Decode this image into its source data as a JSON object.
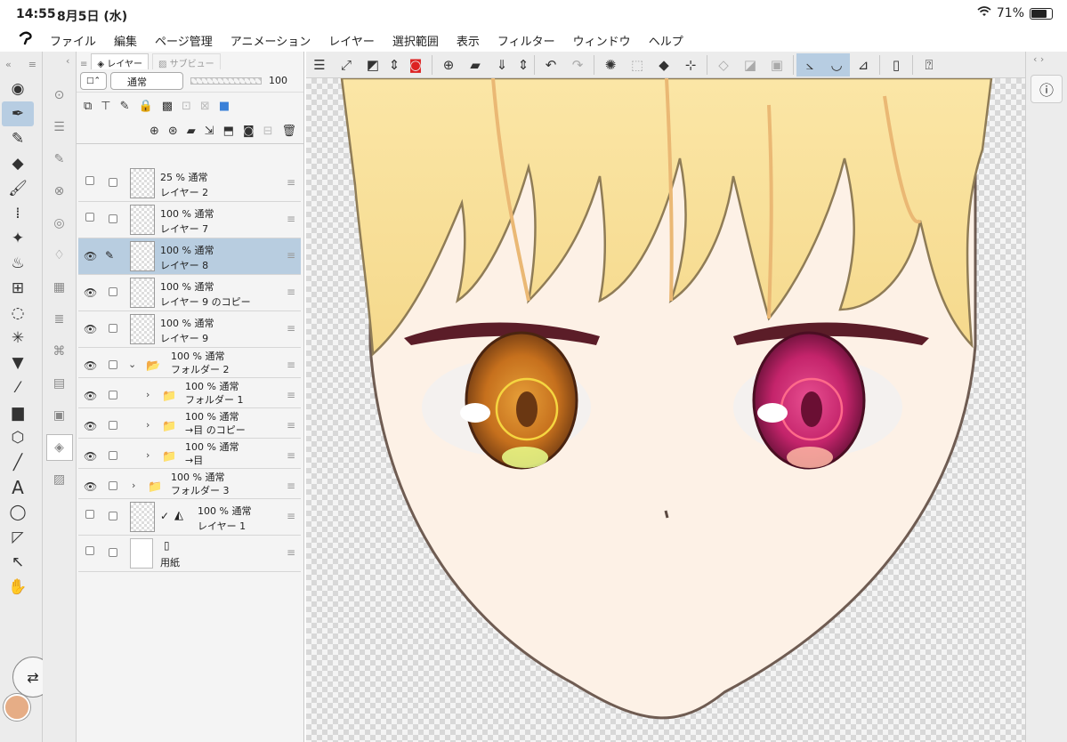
{
  "status": {
    "time": "14:55",
    "date": "8月5日 (水)",
    "battery": "71%"
  },
  "menu": [
    "ファイル",
    "編集",
    "ページ管理",
    "アニメーション",
    "レイヤー",
    "選択範囲",
    "表示",
    "フィルター",
    "ウィンドウ",
    "ヘルプ"
  ],
  "panel": {
    "tab_layer": "レイヤー",
    "tab_sub": "サブビュー",
    "blend": "通常",
    "opacity": "100"
  },
  "layers": [
    {
      "pct": "25 % 通常",
      "name": "レイヤー 2",
      "visible": false,
      "sel": false,
      "indent": 0,
      "type": "raster"
    },
    {
      "pct": "100 % 通常",
      "name": "レイヤー 7",
      "visible": false,
      "sel": false,
      "indent": 0,
      "type": "raster"
    },
    {
      "pct": "100 % 通常",
      "name": "レイヤー 8",
      "visible": true,
      "sel": true,
      "indent": 0,
      "type": "raster"
    },
    {
      "pct": "100 % 通常",
      "name": "レイヤー 9 のコピー",
      "visible": true,
      "sel": false,
      "indent": 0,
      "type": "raster"
    },
    {
      "pct": "100 % 通常",
      "name": "レイヤー 9",
      "visible": true,
      "sel": false,
      "indent": 0,
      "type": "raster"
    },
    {
      "pct": "100 % 通常",
      "name": "フォルダー 2",
      "visible": true,
      "sel": false,
      "indent": 0,
      "type": "folder-open"
    },
    {
      "pct": "100 % 通常",
      "name": "フォルダー 1",
      "visible": true,
      "sel": false,
      "indent": 1,
      "type": "folder"
    },
    {
      "pct": "100 % 通常",
      "name": "→目 のコピー",
      "visible": true,
      "sel": false,
      "indent": 1,
      "type": "folder"
    },
    {
      "pct": "100 % 通常",
      "name": "→目",
      "visible": true,
      "sel": false,
      "indent": 1,
      "type": "folder"
    },
    {
      "pct": "100 % 通常",
      "name": "フォルダー 3",
      "visible": true,
      "sel": false,
      "indent": 0,
      "type": "folder"
    },
    {
      "pct": "100 % 通常",
      "name": "レイヤー 1",
      "visible": false,
      "sel": false,
      "indent": 0,
      "type": "draft"
    },
    {
      "pct": "",
      "name": "用紙",
      "visible": false,
      "sel": false,
      "indent": 0,
      "type": "paper"
    }
  ],
  "colors": {
    "accent": "#b8cde0",
    "primary_color": "#e6ad86",
    "skin": "#fdf1e6",
    "hair": "#f7e3a3",
    "eye_left": "#c4701c",
    "eye_right": "#c5246d"
  }
}
